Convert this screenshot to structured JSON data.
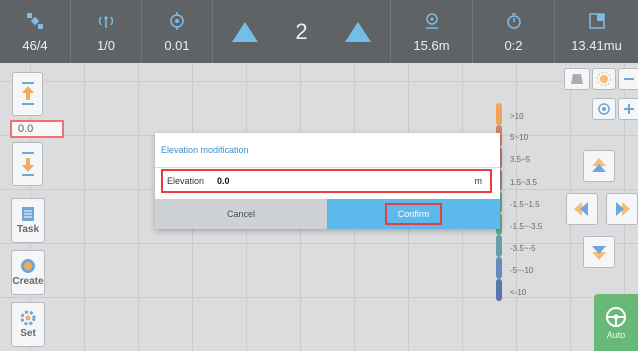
{
  "status_bar": {
    "satellites": "46/4",
    "signal": "1/0",
    "accuracy": "0.01",
    "center_value": "2",
    "distance": "15.6m",
    "time": "0:2",
    "speed": "13.41mu"
  },
  "left_toolbar": {
    "elevation_value": "0.0",
    "task_label": "Task",
    "create_label": "Create",
    "set_label": "Set"
  },
  "legend": {
    "labels": [
      ">10",
      "5~10",
      "3.5~5",
      "1.5~3.5",
      "-1.5~1.5",
      "-1.5~-3.5",
      "-3.5~-5",
      "-5~-10",
      "<-10"
    ],
    "colors": [
      "#e8821a",
      "#b85a2a",
      "#9a4740",
      "#7b4f4f",
      "#2e8b57",
      "#2a8a70",
      "#2c7a86",
      "#2a5ea3",
      "#1a3e8c"
    ]
  },
  "auto_label": "Auto",
  "dialog": {
    "title": "Elevation modification",
    "field_label": "Elevation",
    "field_value": "0.0",
    "unit": "m",
    "cancel_label": "Cancel",
    "confirm_label": "Confirm"
  },
  "colors": {
    "accent": "#5db9ec",
    "highlight": "#e53e3e",
    "topbar": "#23272c"
  }
}
